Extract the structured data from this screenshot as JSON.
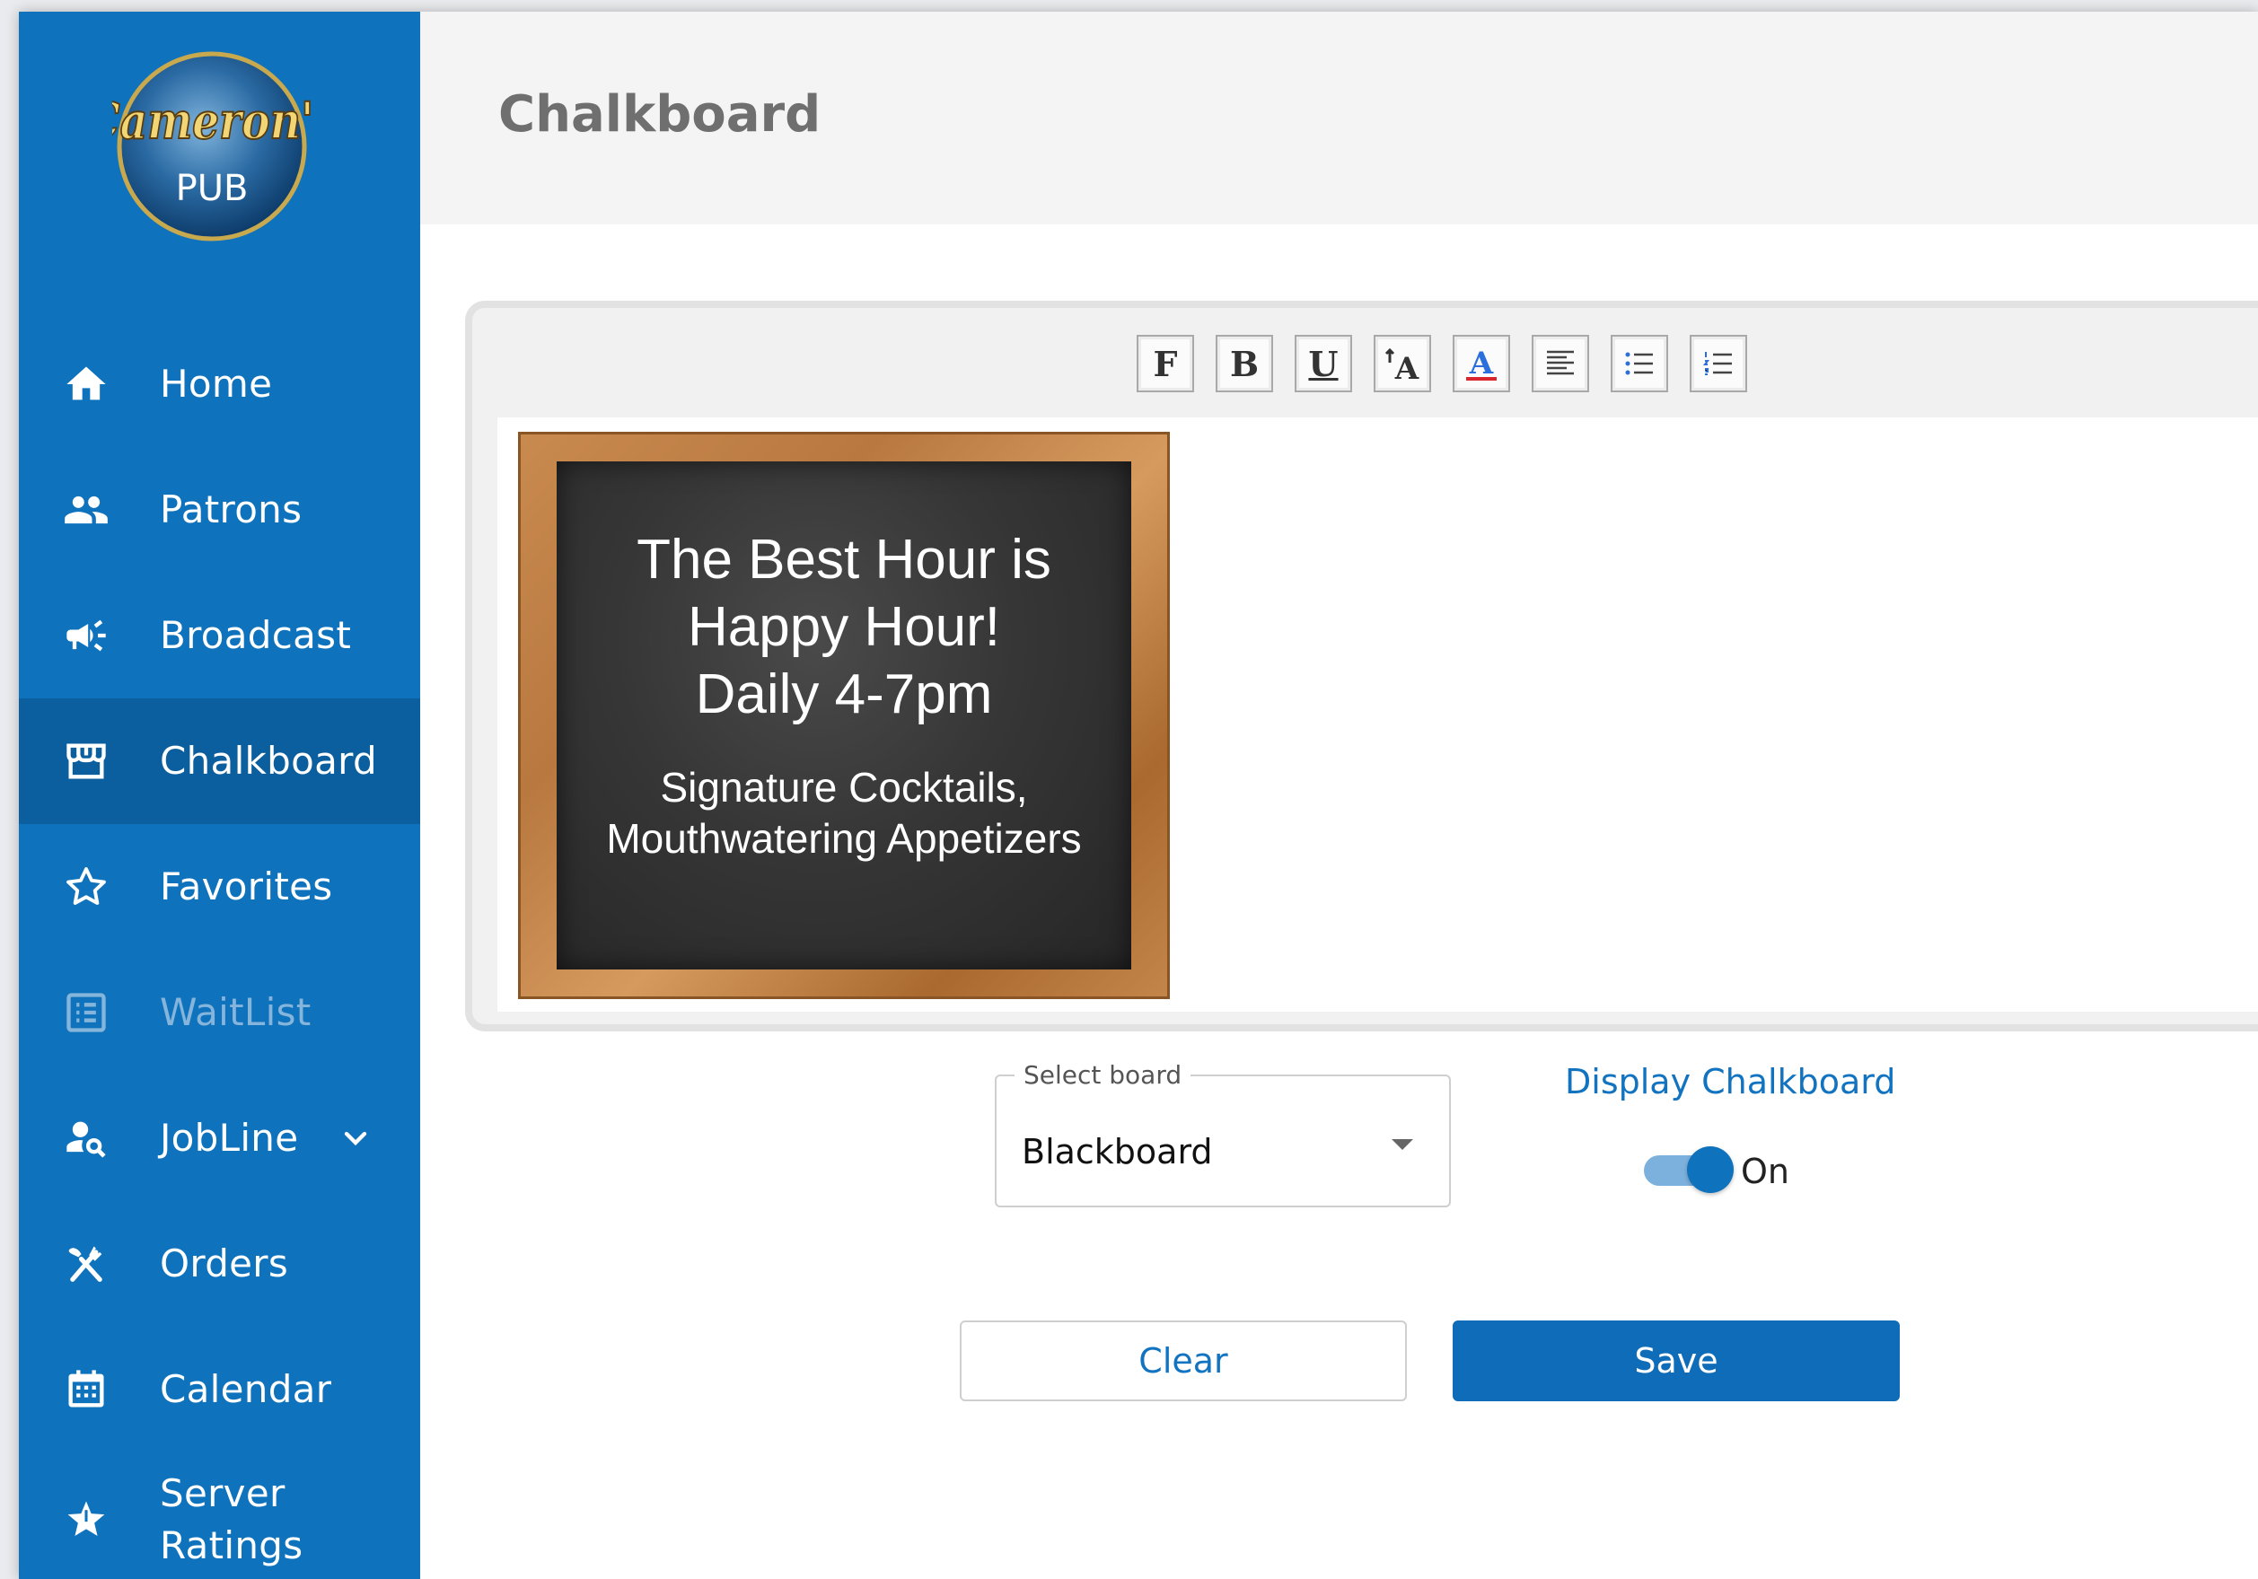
{
  "colors": {
    "sidebar_bg": "#0f72bd",
    "sidebar_active_bg": "#0b5f9e",
    "accent": "#1273c0",
    "primary_button": "#0f6cb8"
  },
  "logo": {
    "script_text": "Cameron's",
    "sub_text": "PUB"
  },
  "sidebar": {
    "items": [
      {
        "label": "Home",
        "icon": "home-icon"
      },
      {
        "label": "Patrons",
        "icon": "people-icon"
      },
      {
        "label": "Broadcast",
        "icon": "megaphone-icon"
      },
      {
        "label": "Chalkboard",
        "icon": "storefront-icon",
        "active": true
      },
      {
        "label": "Favorites",
        "icon": "star-outline-icon"
      },
      {
        "label": "WaitList",
        "icon": "list-icon",
        "disabled": true
      },
      {
        "label": "JobLine",
        "icon": "person-search-icon",
        "expandable": true
      },
      {
        "label": "Orders",
        "icon": "utensils-icon"
      },
      {
        "label": "Calendar",
        "icon": "calendar-icon"
      },
      {
        "label": "Server\nRatings",
        "icon": "star-rating-icon"
      }
    ]
  },
  "header": {
    "title": "Chalkboard"
  },
  "toolbar": {
    "buttons": [
      {
        "label": "F",
        "icon": "font-family-icon"
      },
      {
        "label": "B",
        "icon": "bold-icon"
      },
      {
        "label": "U",
        "icon": "underline-icon"
      },
      {
        "label": "A",
        "icon": "font-size-icon"
      },
      {
        "label": "A",
        "icon": "font-color-icon"
      },
      {
        "label": "",
        "icon": "align-left-icon"
      },
      {
        "label": "",
        "icon": "bulleted-list-icon"
      },
      {
        "label": "",
        "icon": "numbered-list-icon"
      }
    ]
  },
  "chalkboard": {
    "headline": "The Best Hour is\nHappy Hour!\nDaily 4-7pm",
    "subtext": "Signature Cocktails,\nMouthwatering Appetizers"
  },
  "board_select": {
    "label": "Select board",
    "value": "Blackboard"
  },
  "display": {
    "label": "Display Chalkboard",
    "state": "On",
    "enabled": true
  },
  "actions": {
    "clear_label": "Clear",
    "save_label": "Save"
  }
}
